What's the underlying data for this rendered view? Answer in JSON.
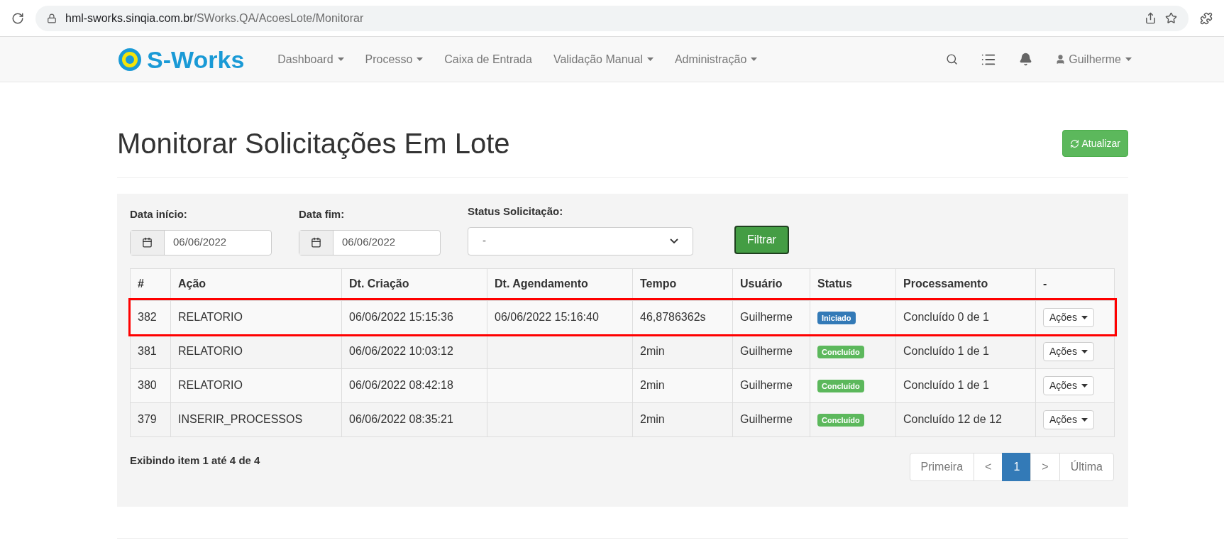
{
  "browser": {
    "url_host": "hml-sworks.sinqia.com.br",
    "url_path": "/SWorks.QA/AcoesLote/Monitorar"
  },
  "navbar": {
    "logo": "S-Works",
    "menu": [
      {
        "label": "Dashboard",
        "dropdown": true
      },
      {
        "label": "Processo",
        "dropdown": true
      },
      {
        "label": "Caixa de Entrada",
        "dropdown": false
      },
      {
        "label": "Validação Manual",
        "dropdown": true
      },
      {
        "label": "Administração",
        "dropdown": true
      }
    ],
    "user": "Guilherme"
  },
  "page": {
    "title": "Monitorar Solicitações Em Lote",
    "refresh_button": "Atualizar"
  },
  "filters": {
    "start": {
      "label": "Data início:",
      "value": "06/06/2022"
    },
    "end": {
      "label": "Data fim:",
      "value": "06/06/2022"
    },
    "status": {
      "label": "Status Solicitação:",
      "value": "-"
    },
    "button": "Filtrar"
  },
  "table": {
    "columns": [
      "#",
      "Ação",
      "Dt. Criação",
      "Dt. Agendamento",
      "Tempo",
      "Usuário",
      "Status",
      "Processamento",
      "-"
    ],
    "rows": [
      {
        "id": "382",
        "action": "RELATORIO",
        "created": "06/06/2022 15:15:36",
        "scheduled": "06/06/2022 15:16:40",
        "time": "46,8786362s",
        "user": "Guilherme",
        "status": {
          "label": "Iniciado",
          "color": "#337ab7"
        },
        "processing": "Concluído 0 de 1",
        "actions": "Ações",
        "highlighted": true
      },
      {
        "id": "381",
        "action": "RELATORIO",
        "created": "06/06/2022 10:03:12",
        "time": "2min",
        "user": "Guilherme",
        "status": {
          "label": "Concluído",
          "color": "#5cb85c"
        },
        "processing": "Concluído 1 de 1",
        "actions": "Ações",
        "highlighted": false
      },
      {
        "id": "380",
        "action": "RELATORIO",
        "created": "06/06/2022 08:42:18",
        "time": "2min",
        "user": "Guilherme",
        "status": {
          "label": "Concluído",
          "color": "#5cb85c"
        },
        "processing": "Concluído 1 de 1",
        "actions": "Ações",
        "highlighted": false
      },
      {
        "id": "379",
        "action": "INSERIR_PROCESSOS",
        "created": "06/06/2022 08:35:21",
        "time": "2min",
        "user": "Guilherme",
        "status": {
          "label": "Concluído",
          "color": "#5cb85c"
        },
        "processing": "Concluído 12 de 12",
        "actions": "Ações",
        "highlighted": false
      }
    ]
  },
  "footer": {
    "summary": "Exibindo item 1 até 4 de 4",
    "pagination": [
      {
        "label": "Primeira",
        "selected": false
      },
      {
        "label": "<",
        "selected": false
      },
      {
        "label": "1",
        "selected": true
      },
      {
        "label": ">",
        "selected": false
      },
      {
        "label": "Última",
        "selected": false
      }
    ]
  }
}
